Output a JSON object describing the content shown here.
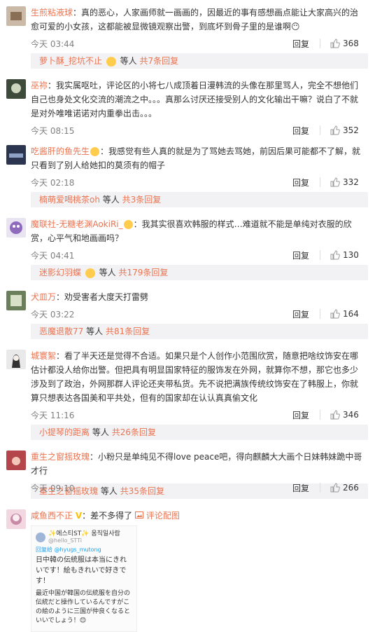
{
  "colors": {
    "accent": "#eb7350",
    "sub_bg": "#f2f2f5",
    "text": "#333333",
    "meta": "#808080"
  },
  "labels": {
    "reply": "回复",
    "sep": "："
  },
  "comments": [
    {
      "user": "生煎粘液球",
      "text": "真的恶心，人家画师就一画画的，因最近的事有感想画点能让大家高兴的治愈可爱的小女孩，这都能被显微镜观察出警，到底坏到骨子里的是谁啊😶",
      "time": "今天 03:44",
      "likes": "368",
      "sub": {
        "user": "萝卜酥_挖坑不止",
        "mid": "等人",
        "count": "共7条回复"
      },
      "avatar": {
        "bg": "#c9b9a6",
        "fg": "#8a6f57"
      }
    },
    {
      "user": "巫祢",
      "text": "我实属呕吐，评论区的小将七八成顶着日漫韩流的头像在那里骂人，完全不想他们自己也身处文化交流的潮流之中。。。真那么讨厌还接受别人的文化输出干嘛？说白了不就是对外唯唯诺诺对内重拳出击。。。",
      "time": "今天 08:15",
      "likes": "352",
      "sub": null,
      "avatar": {
        "bg": "#3e4a3a",
        "fg": "#cfd6c0"
      }
    },
    {
      "user": "吃酱肝的鱼先生",
      "text": "我感觉有些人真的就是为了骂她去骂她，前因后果可能都不了解，就只看到了别人给她扣的莫须有的帽子",
      "time": "今天 02:18",
      "likes": "332",
      "sub": {
        "user": "楠萌爱喝桃茶oh",
        "mid": "等人",
        "count": "共3条回复"
      },
      "avatar": {
        "bg": "#2c3550",
        "fg": "#8ea2c8"
      }
    },
    {
      "user": "魔联社-无糖老渊AokiRi_",
      "text": "我其实很喜欢韩服的样式…难道就不能是单纯对衣服的欣赏，心平气和地画画吗？",
      "time": "今天 04:41",
      "likes": "130",
      "sub": {
        "user": "迷影幻羽蝶",
        "mid": "等人",
        "count": "共179条回复"
      },
      "avatar": {
        "bg": "#e8e4f2",
        "fg": "#8e6bbd"
      }
    },
    {
      "user": "犬皿万",
      "text": "劝受害者大度天打雷劈",
      "time": "今天 03:22",
      "likes": "164",
      "sub": {
        "user": "恶魔退散77",
        "mid": "等人",
        "count": "共81条回复"
      },
      "avatar": {
        "bg": "#6a7f5a",
        "fg": "#d8e0c8"
      }
    },
    {
      "user": "城寰絮",
      "text": "看了半天还是觉得不合适。如果只是个人创作小范围欣赏，随意把啥纹饰安在哪估计都没人给你出警。但把具有明显国家特征的服饰发在外网，就算你不想，那它也多少涉及到了政治，外网那群人评论还夹带私货。先不说把满族传统纹饰安在了韩服上，你就算只想表达各国美和平共处，但有的国家却在认认真真偷文化",
      "time": "今天 11:16",
      "likes": "346",
      "sub": {
        "user": "小提琴的距离",
        "mid": "等人",
        "count": "共26条回复"
      },
      "avatar": {
        "bg": "#e9e9e9",
        "fg": "#333333"
      }
    },
    {
      "user": "重生之窗摇玫瑰",
      "text": "小粉只是单纯见不得love peace吧，得向麒麟大大画个日妹韩妹跪中哥才行",
      "time": "今天 09:10",
      "likes": "266",
      "sub": {
        "user": "重生之窗摇玫瑰",
        "mid": "等人",
        "count": "共35条回复"
      },
      "avatar": {
        "bg": "#b4454a",
        "fg": "#f2c6b9"
      }
    },
    {
      "user": "咸鱼西不正",
      "text": "差不多得了",
      "pic_link": "评论配图",
      "avatar": {
        "bg": "#f3d7e0",
        "fg": "#c98aa6"
      },
      "image": {
        "name": "✨에스티ST✨ 움직일사람",
        "handle": "@hello_STTi",
        "reply_to": "回复给 @hyugs_mutong",
        "line1": "日中韓の伝統服は本当にきれいです！絵もきれいで好きです！",
        "line2": "最近中国が韓国の伝統服を自分の伝統だと操作しているんですがこの絵のように三国が仲良くなるといいでしょう！😊"
      }
    }
  ]
}
